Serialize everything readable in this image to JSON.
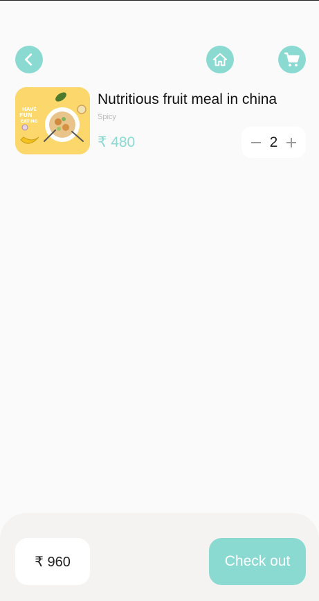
{
  "header": {
    "back_icon": "chevron-left-icon",
    "home_icon": "home-icon",
    "cart_icon": "shopping-cart-icon",
    "accent_color": "#8bdad2"
  },
  "cart": {
    "items": [
      {
        "title": "Nutritious fruit meal in china",
        "subtitle": "Spicy",
        "price": "₹ 480",
        "quantity": "2",
        "image_icon": "food-plate-image"
      }
    ]
  },
  "footer": {
    "total": "₹ 960",
    "checkout_label": "Check out"
  }
}
